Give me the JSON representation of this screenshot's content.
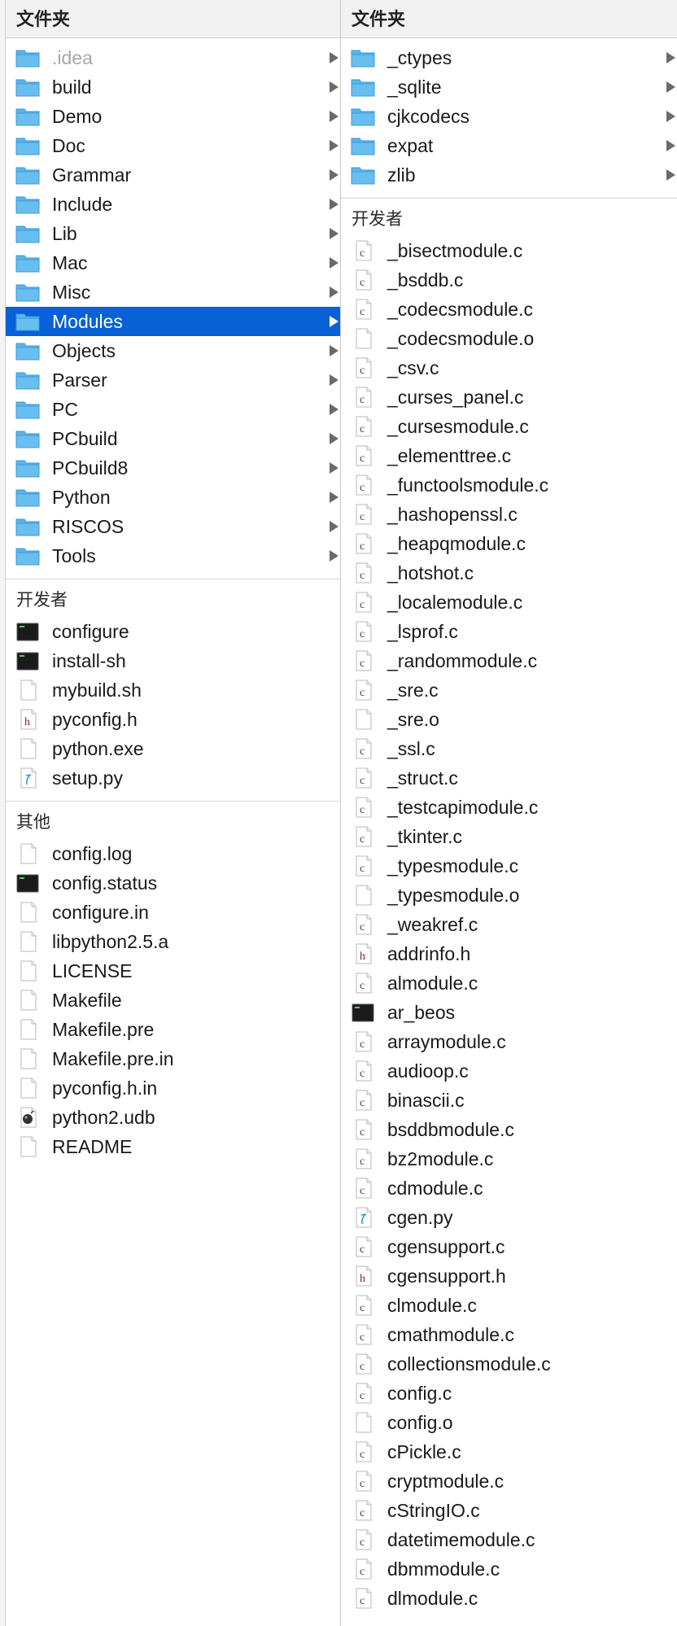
{
  "column1": {
    "header": "文件夹",
    "folders": [
      {
        "label": ".idea",
        "dim": true
      },
      {
        "label": "build"
      },
      {
        "label": "Demo"
      },
      {
        "label": "Doc"
      },
      {
        "label": "Grammar"
      },
      {
        "label": "Include"
      },
      {
        "label": "Lib"
      },
      {
        "label": "Mac"
      },
      {
        "label": "Misc"
      },
      {
        "label": "Modules",
        "selected": true
      },
      {
        "label": "Objects"
      },
      {
        "label": "Parser"
      },
      {
        "label": "PC"
      },
      {
        "label": "PCbuild"
      },
      {
        "label": "PCbuild8"
      },
      {
        "label": "Python"
      },
      {
        "label": "RISCOS"
      },
      {
        "label": "Tools"
      }
    ],
    "developer_title": "开发者",
    "developer_files": [
      {
        "label": "configure",
        "icon": "terminal"
      },
      {
        "label": "install-sh",
        "icon": "terminal"
      },
      {
        "label": "mybuild.sh",
        "icon": "blank"
      },
      {
        "label": "pyconfig.h",
        "icon": "h"
      },
      {
        "label": "python.exe",
        "icon": "blank"
      },
      {
        "label": "setup.py",
        "icon": "py"
      }
    ],
    "other_title": "其他",
    "other_files": [
      {
        "label": "config.log",
        "icon": "blank"
      },
      {
        "label": "config.status",
        "icon": "terminal"
      },
      {
        "label": "configure.in",
        "icon": "blank"
      },
      {
        "label": "libpython2.5.a",
        "icon": "blank"
      },
      {
        "label": "LICENSE",
        "icon": "blank"
      },
      {
        "label": "Makefile",
        "icon": "blank"
      },
      {
        "label": "Makefile.pre",
        "icon": "blank"
      },
      {
        "label": "Makefile.pre.in",
        "icon": "blank"
      },
      {
        "label": "pyconfig.h.in",
        "icon": "blank"
      },
      {
        "label": "python2.udb",
        "icon": "udb"
      },
      {
        "label": "README",
        "icon": "blank"
      }
    ]
  },
  "column2": {
    "header": "文件夹",
    "folders": [
      {
        "label": "_ctypes"
      },
      {
        "label": "_sqlite"
      },
      {
        "label": "cjkcodecs"
      },
      {
        "label": "expat"
      },
      {
        "label": "zlib"
      }
    ],
    "developer_title": "开发者",
    "developer_files": [
      {
        "label": "_bisectmodule.c",
        "icon": "c"
      },
      {
        "label": "_bsddb.c",
        "icon": "c"
      },
      {
        "label": "_codecsmodule.c",
        "icon": "c"
      },
      {
        "label": "_codecsmodule.o",
        "icon": "blank"
      },
      {
        "label": "_csv.c",
        "icon": "c"
      },
      {
        "label": "_curses_panel.c",
        "icon": "c"
      },
      {
        "label": "_cursesmodule.c",
        "icon": "c"
      },
      {
        "label": "_elementtree.c",
        "icon": "c"
      },
      {
        "label": "_functoolsmodule.c",
        "icon": "c"
      },
      {
        "label": "_hashopenssl.c",
        "icon": "c"
      },
      {
        "label": "_heapqmodule.c",
        "icon": "c"
      },
      {
        "label": "_hotshot.c",
        "icon": "c"
      },
      {
        "label": "_localemodule.c",
        "icon": "c"
      },
      {
        "label": "_lsprof.c",
        "icon": "c"
      },
      {
        "label": "_randommodule.c",
        "icon": "c"
      },
      {
        "label": "_sre.c",
        "icon": "c"
      },
      {
        "label": "_sre.o",
        "icon": "blank"
      },
      {
        "label": "_ssl.c",
        "icon": "c"
      },
      {
        "label": "_struct.c",
        "icon": "c"
      },
      {
        "label": "_testcapimodule.c",
        "icon": "c"
      },
      {
        "label": "_tkinter.c",
        "icon": "c"
      },
      {
        "label": "_typesmodule.c",
        "icon": "c"
      },
      {
        "label": "_typesmodule.o",
        "icon": "blank"
      },
      {
        "label": "_weakref.c",
        "icon": "c"
      },
      {
        "label": "addrinfo.h",
        "icon": "h"
      },
      {
        "label": "almodule.c",
        "icon": "c"
      },
      {
        "label": "ar_beos",
        "icon": "terminal"
      },
      {
        "label": "arraymodule.c",
        "icon": "c"
      },
      {
        "label": "audioop.c",
        "icon": "c"
      },
      {
        "label": "binascii.c",
        "icon": "c"
      },
      {
        "label": "bsddbmodule.c",
        "icon": "c"
      },
      {
        "label": "bz2module.c",
        "icon": "c"
      },
      {
        "label": "cdmodule.c",
        "icon": "c"
      },
      {
        "label": "cgen.py",
        "icon": "py"
      },
      {
        "label": "cgensupport.c",
        "icon": "c"
      },
      {
        "label": "cgensupport.h",
        "icon": "h"
      },
      {
        "label": "clmodule.c",
        "icon": "c"
      },
      {
        "label": "cmathmodule.c",
        "icon": "c"
      },
      {
        "label": "collectionsmodule.c",
        "icon": "c"
      },
      {
        "label": "config.c",
        "icon": "c"
      },
      {
        "label": "config.o",
        "icon": "blank"
      },
      {
        "label": "cPickle.c",
        "icon": "c"
      },
      {
        "label": "cryptmodule.c",
        "icon": "c"
      },
      {
        "label": "cStringIO.c",
        "icon": "c"
      },
      {
        "label": "datetimemodule.c",
        "icon": "c"
      },
      {
        "label": "dbmmodule.c",
        "icon": "c"
      },
      {
        "label": "dlmodule.c",
        "icon": "c"
      }
    ]
  },
  "colors": {
    "selection": "#0861d6",
    "folder": "#5ab4ec",
    "header_bg": "#f2f2f2"
  }
}
